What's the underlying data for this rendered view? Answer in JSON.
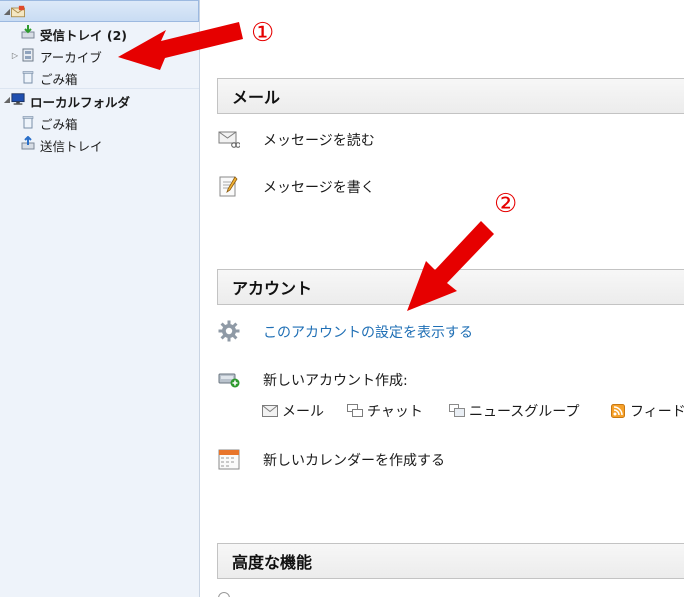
{
  "folders": {
    "inbox": "受信トレイ (2)",
    "archive": "アーカイブ",
    "trash1": "ごみ箱",
    "local_folders": "ローカルフォルダ",
    "trash2": "ごみ箱",
    "sent": "送信トレイ"
  },
  "sections": {
    "mail": {
      "title": "メール",
      "read": "メッセージを読む",
      "write": "メッセージを書く"
    },
    "account": {
      "title": "アカウント",
      "view_settings": "このアカウントの設定を表示する",
      "new_account": "新しいアカウント作成:",
      "sub": {
        "mail": "メール",
        "chat": "チャット",
        "news": "ニュースグループ",
        "feed": "フィード"
      },
      "new_calendar": "新しいカレンダーを作成する"
    },
    "advanced": {
      "title": "高度な機能"
    }
  },
  "annotations": {
    "one": "①",
    "two": "②",
    "arrow_color": "#e60000"
  }
}
